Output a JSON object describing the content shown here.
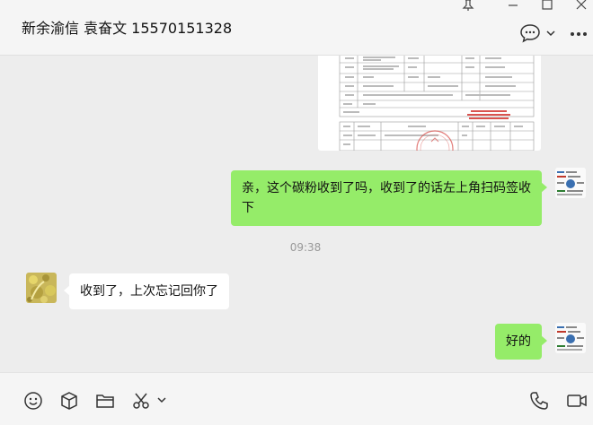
{
  "header": {
    "title": "新余渝信 袁奋文 15570151328"
  },
  "messages": [
    {
      "sender": "me",
      "type": "image",
      "content": "delivery-receipt-document"
    },
    {
      "sender": "me",
      "type": "text",
      "text": "亲，这个碳粉收到了吗，收到了的话左上角扫码签收下"
    },
    {
      "type": "time",
      "text": "09:38"
    },
    {
      "sender": "other",
      "type": "text",
      "text": "收到了，上次忘记回你了"
    },
    {
      "sender": "me",
      "type": "text",
      "text": "好的"
    }
  ],
  "toolbar": {
    "icons": [
      "emoji-icon",
      "box-icon",
      "folder-icon",
      "scissors-icon",
      "phone-icon",
      "video-icon"
    ]
  },
  "colors": {
    "my_bubble": "#95ec69",
    "other_bubble": "#ffffff",
    "background": "#ededed",
    "stamp_red": "#d9534f"
  }
}
